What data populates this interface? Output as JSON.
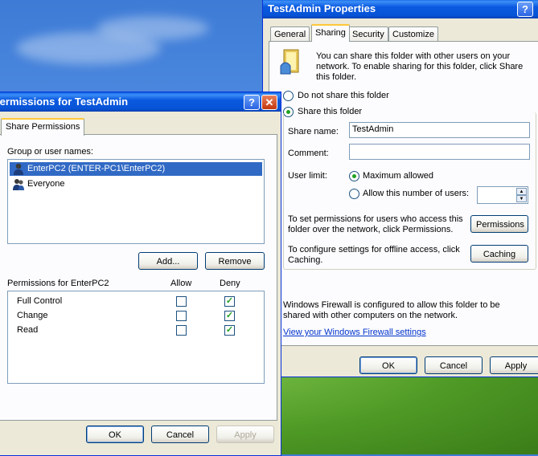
{
  "properties_window": {
    "title": "TestAdmin Properties",
    "tabs": [
      {
        "label": "General",
        "active": false
      },
      {
        "label": "Sharing",
        "active": true
      },
      {
        "label": "Security",
        "active": false
      },
      {
        "label": "Customize",
        "active": false
      }
    ],
    "intro_text": "You can share this folder with other users on your network.  To enable sharing for this folder, click Share this folder.",
    "do_not_share_label": "Do not share this folder",
    "share_label": "Share this folder",
    "share_name_label": "Share name:",
    "share_name_value": "TestAdmin",
    "comment_label": "Comment:",
    "comment_value": "",
    "user_limit_label": "User limit:",
    "max_allowed_label": "Maximum allowed",
    "allow_number_label": "Allow this number of users:",
    "permissions_text": "To set permissions for users who access this folder over the network, click Permissions.",
    "permissions_button": "Permissions",
    "caching_text": "To configure settings for offline access, click Caching.",
    "caching_button": "Caching",
    "firewall_text": "Windows Firewall is configured to allow this folder to be shared with other computers on the network.",
    "firewall_link": "View your Windows Firewall settings",
    "ok_button": "OK",
    "cancel_button": "Cancel",
    "apply_button": "Apply"
  },
  "permissions_window": {
    "title": "Permissions for TestAdmin",
    "tab_label": "Share Permissions",
    "group_label": "Group or user names:",
    "users": [
      {
        "name": "EnterPC2 (ENTER-PC1\\EnterPC2)",
        "selected": true
      },
      {
        "name": "Everyone",
        "selected": false
      }
    ],
    "add_button": "Add...",
    "remove_button": "Remove",
    "permissions_for_label": "Permissions for EnterPC2",
    "allow_header": "Allow",
    "deny_header": "Deny",
    "permissions": [
      {
        "name": "Full Control",
        "allow": false,
        "deny": true
      },
      {
        "name": "Change",
        "allow": false,
        "deny": true
      },
      {
        "name": "Read",
        "allow": false,
        "deny": true
      }
    ],
    "ok_button": "OK",
    "cancel_button": "Cancel",
    "apply_button": "Apply"
  },
  "icons": {
    "help": "?",
    "close": "✕",
    "check": "✓"
  },
  "colors": {
    "titlebar": "#0754d6",
    "selection": "#316ac5",
    "check": "#21a121"
  }
}
